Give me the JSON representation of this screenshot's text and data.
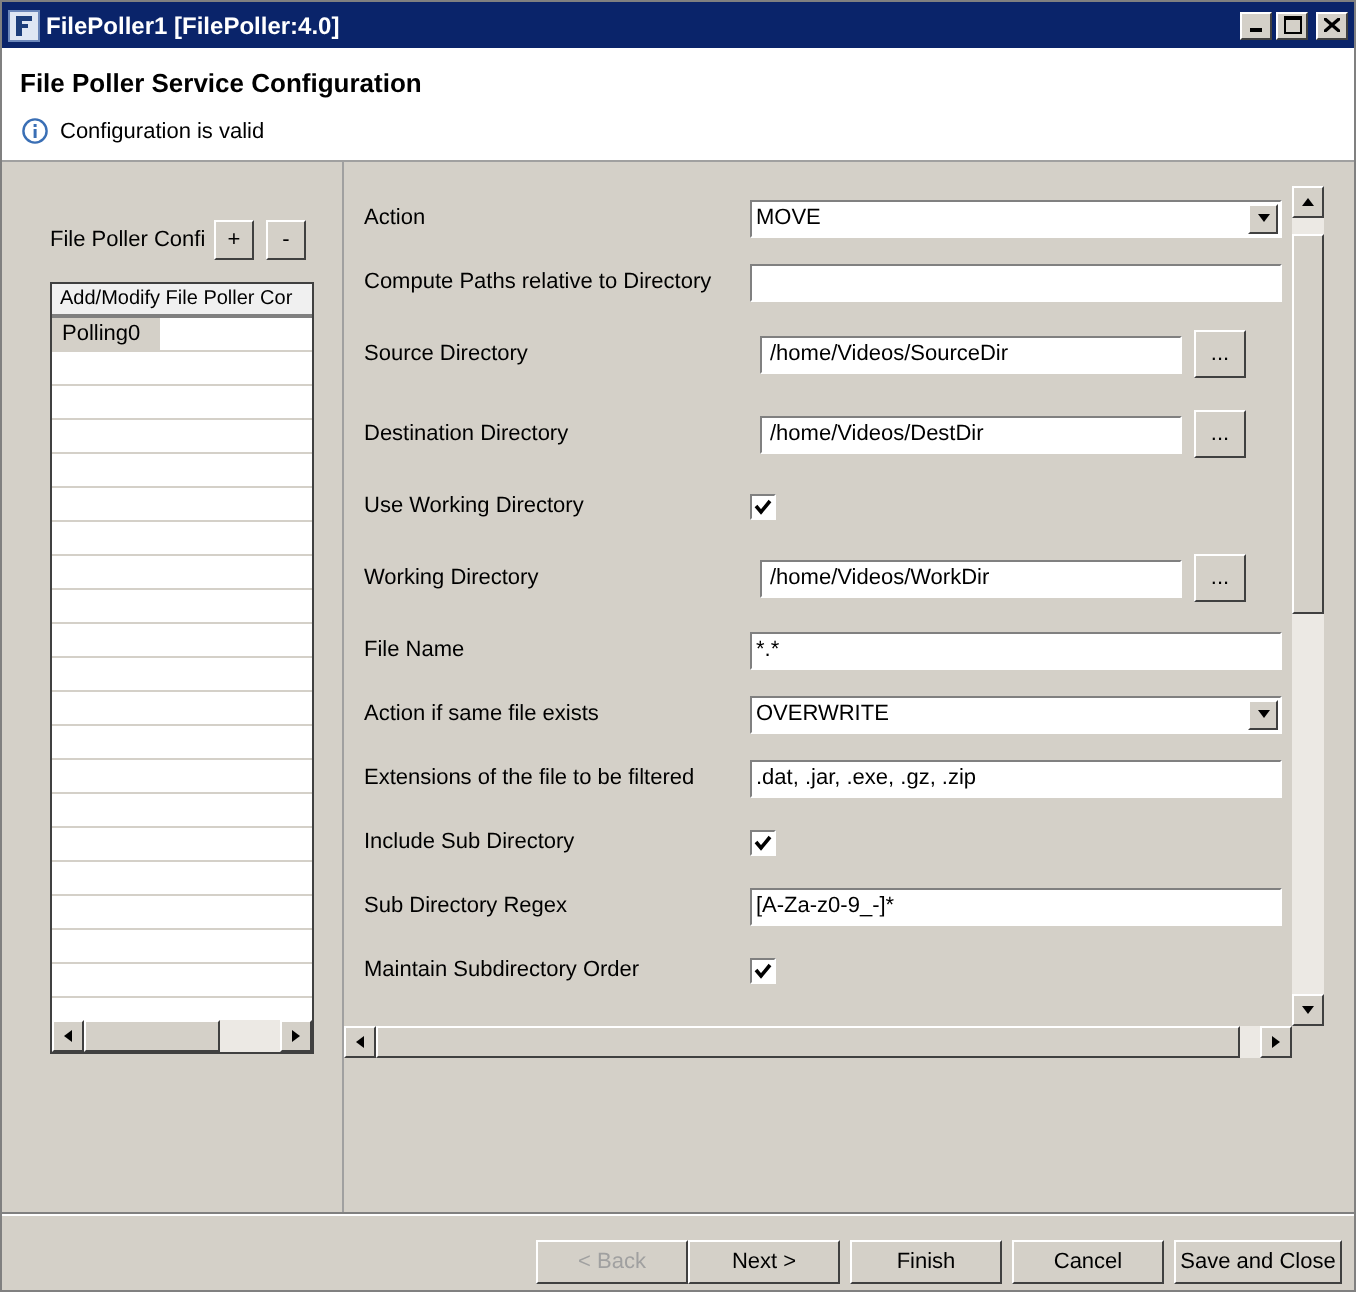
{
  "window": {
    "title": "FilePoller1 [FilePoller:4.0]"
  },
  "header": {
    "title": "File Poller Service Configuration",
    "message": "Configuration is valid"
  },
  "left_panel": {
    "label": "File Poller Confi",
    "add": "+",
    "remove": "-",
    "column": "Add/Modify File Poller Cor",
    "rows": [
      {
        "name": "Polling0",
        "selected": true
      }
    ]
  },
  "form": [
    {
      "kind": "dropdown",
      "label": "Action",
      "value": "MOVE"
    },
    {
      "kind": "text",
      "label": "Compute Paths relative to Directory"
    },
    {
      "kind": "browse",
      "label": "Source Directory",
      "value": "/home/Videos/SourceDir",
      "button": "..."
    },
    {
      "kind": "browse",
      "label": "Destination Directory",
      "value": "/home/Videos/DestDir",
      "button": "..."
    },
    {
      "kind": "checkbox",
      "label": "Use Working Directory",
      "checked": true
    },
    {
      "kind": "browse",
      "label": "Working Directory",
      "value": "/home/Videos/WorkDir",
      "button": "..."
    },
    {
      "kind": "text",
      "label": "File Name",
      "value": "*.*"
    },
    {
      "kind": "dropdown",
      "label": "Action if same file exists",
      "value": "OVERWRITE"
    },
    {
      "kind": "text",
      "label": "Extensions of the file to be filtered",
      "value": ".dat, .jar, .exe, .gz, .zip"
    },
    {
      "kind": "checkbox",
      "label": "Include Sub Directory",
      "checked": true
    },
    {
      "kind": "text",
      "label": "Sub Directory Regex",
      "value": "[A-Za-z0-9_-]*"
    },
    {
      "kind": "checkbox",
      "label": "Maintain Subdirectory Order",
      "checked": true
    }
  ],
  "buttons": [
    {
      "label": "< Back",
      "disabled": true
    },
    {
      "label": "Next >",
      "disabled": false
    },
    {
      "label": "Finish",
      "disabled": false
    },
    {
      "label": "Cancel",
      "disabled": false
    },
    {
      "label": "Save and Close",
      "disabled": false
    }
  ]
}
